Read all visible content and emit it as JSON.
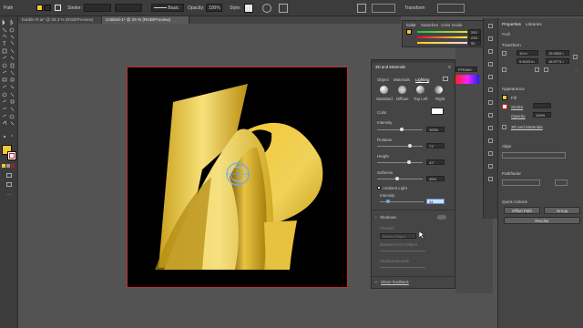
{
  "controlbar": {
    "selection_label": "Path",
    "stroke_label": "Stroke:",
    "stroke_style": "Basic",
    "opacity_label": "Opacity:",
    "opacity_value": "100%",
    "style_label": "Style:",
    "transform_label": "Transform"
  },
  "tabs": [
    {
      "label": "bubble R.ai* @ 33.3 % (RGB/Preview)"
    },
    {
      "label": "Untitled-1* @ 25 % (RGB/Preview)"
    }
  ],
  "color_panel": {
    "tabs": [
      "Color",
      "Swatches",
      "Color Guide"
    ],
    "r": "252",
    "g": "215",
    "b": "50",
    "hex": "FFD400"
  },
  "panel3d": {
    "title": "3D and Materials",
    "tabs": [
      "Object",
      "Materials",
      "Lighting"
    ],
    "presets": [
      "Standard",
      "Diffuse",
      "Top Left",
      "Right"
    ],
    "color_label": "Color",
    "intensity_label": "Intensity",
    "intensity_value": "100%",
    "rotation_label": "Rotation",
    "rotation_value": "71°",
    "height_label": "Height",
    "height_value": "41°",
    "softness_label": "Softness",
    "softness_value": "45%",
    "ambient_label": "Ambient Light",
    "ambient_intensity_label": "Intensity",
    "ambient_intensity_value": "34",
    "shadows_label": "Shadows",
    "position_label": "Position",
    "position_value": "Behind Object",
    "distance_label": "Distance from Object",
    "bounds_label": "Shadow Bounds",
    "feedback_label": "Share feedback"
  },
  "properties": {
    "tabs": [
      "Properties",
      "Libraries"
    ],
    "path_label": "Path",
    "transform_label": "Transform",
    "x_value": "10 in",
    "y_value": "9.6023 in",
    "w_value": "15.9009 i",
    "h_value": "16.9771 i",
    "appearance_label": "Appearance",
    "fill_label": "Fill",
    "stroke_label": "Stroke",
    "opacity_label": "Opacity",
    "opacity_value": "100%",
    "fx_label": "3D and Materials",
    "align_label": "Align",
    "pathfinder_label": "Pathfinder",
    "quick_actions_label": "Quick Actions",
    "offset_path_label": "Offset Path",
    "group_label": "Group",
    "recolor_label": "Recolor"
  },
  "colors": {
    "accent_yellow": "#f3c832",
    "ui_dark": "#3c3c3c",
    "artboard_border": "#c03030"
  }
}
